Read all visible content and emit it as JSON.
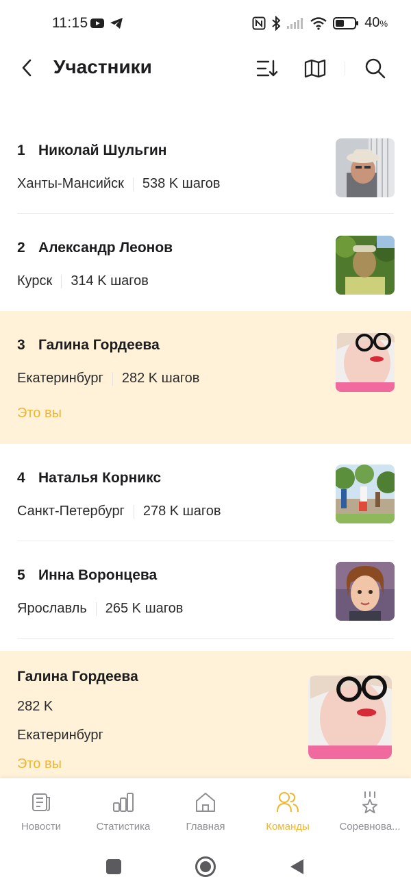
{
  "status_bar": {
    "time": "11:15",
    "battery": "40",
    "battery_unit": "%"
  },
  "header": {
    "title": "Участники"
  },
  "participants": [
    {
      "rank": "1",
      "name": "Николай Шульгин",
      "city": "Ханты-Мансийск",
      "steps": "538 K шагов",
      "you": ""
    },
    {
      "rank": "2",
      "name": "Александр Леонов",
      "city": "Курск",
      "steps": "314 K шагов",
      "you": ""
    },
    {
      "rank": "3",
      "name": "Галина Гордеева",
      "city": "Екатеринбург",
      "steps": "282 K шагов",
      "you": "Это вы"
    },
    {
      "rank": "4",
      "name": "Наталья Корникс",
      "city": "Санкт-Петербург",
      "steps": "278 K шагов",
      "you": ""
    },
    {
      "rank": "5",
      "name": "Инна Воронцева",
      "city": "Ярославль",
      "steps": "265 K шагов",
      "you": ""
    }
  ],
  "current_user": {
    "name": "Галина Гордеева",
    "steps": "282 K",
    "city": "Екатеринбург",
    "you": "Это вы"
  },
  "tabs": [
    {
      "label": "Новости",
      "icon": "news-icon"
    },
    {
      "label": "Статистика",
      "icon": "stats-icon"
    },
    {
      "label": "Главная",
      "icon": "home-icon"
    },
    {
      "label": "Команды",
      "icon": "teams-icon"
    },
    {
      "label": "Соревнова...",
      "icon": "trophy-icon"
    }
  ],
  "colors": {
    "accent": "#f0b52c",
    "highlight_bg": "#fff2d9",
    "text": "#1c1c1e",
    "secondary": "#8e8e93"
  }
}
